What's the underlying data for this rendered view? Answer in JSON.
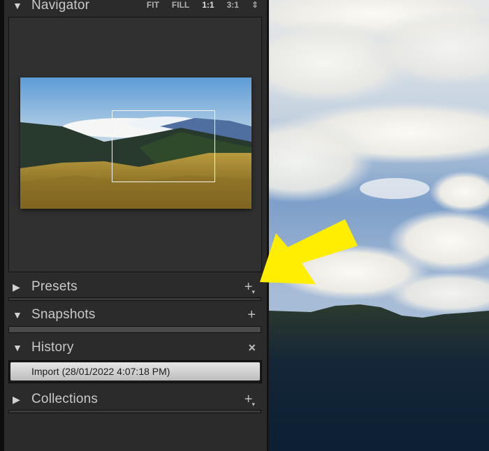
{
  "panel": {
    "navigator": {
      "title": "Navigator",
      "expanded": true,
      "zoom_options": [
        "FIT",
        "FILL",
        "1:1",
        "3:1"
      ],
      "selected_zoom": "1:1"
    },
    "presets": {
      "title": "Presets",
      "expanded": false,
      "action": "+"
    },
    "snapshots": {
      "title": "Snapshots",
      "expanded": true,
      "action": "+"
    },
    "history": {
      "title": "History",
      "expanded": true,
      "action": "×",
      "items": [
        {
          "label": "Import (28/01/2022 4:07:18 PM)",
          "selected": true
        }
      ]
    },
    "collections": {
      "title": "Collections",
      "expanded": false,
      "action": "+"
    }
  },
  "icons": {
    "expanded": "▼",
    "collapsed": "▶",
    "updown": "⇕"
  },
  "colors": {
    "panel_bg": "#2b2b2b",
    "annotation_arrow": "#ffee00",
    "history_selected": "#d6d6d6"
  }
}
